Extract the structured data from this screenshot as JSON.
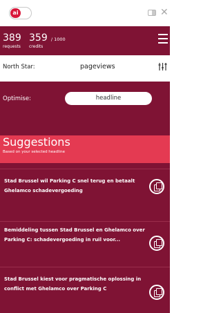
{
  "topbar": {
    "toggle_logo": "ai",
    "close_glyph": "✕"
  },
  "stats": {
    "requests_value": "389",
    "requests_label": "requests",
    "credits_value": "359",
    "credits_limit": "/ 1000",
    "credits_label": "credits"
  },
  "north_star": {
    "label": "North Star:",
    "value": "pageviews"
  },
  "optimise": {
    "label": "Optimise:",
    "value": "headline"
  },
  "suggestions": {
    "title": "Suggestions",
    "subtitle": "Based on your selected headline",
    "items": [
      {
        "text": "Stad Brussel wil Parking C snel terug en betaalt Ghelamco schadevergoeding"
      },
      {
        "text": "Bemiddeling tussen Stad Brussel en Ghelamco over Parking C: schadevergoeding in ruil voor..."
      },
      {
        "text": "Stad Brussel kiest voor pragmatische oplossing in conflict met Ghelamco over Parking C"
      }
    ]
  },
  "colors": {
    "primary_dark": "#7f1334",
    "accent": "#e43a52",
    "logo_red": "#d8173a"
  },
  "icons": {
    "menu": "hamburger-menu-icon",
    "filter": "sliders-icon",
    "copy": "copy-icon",
    "close": "close-icon",
    "minimize": "minimize-icon"
  }
}
